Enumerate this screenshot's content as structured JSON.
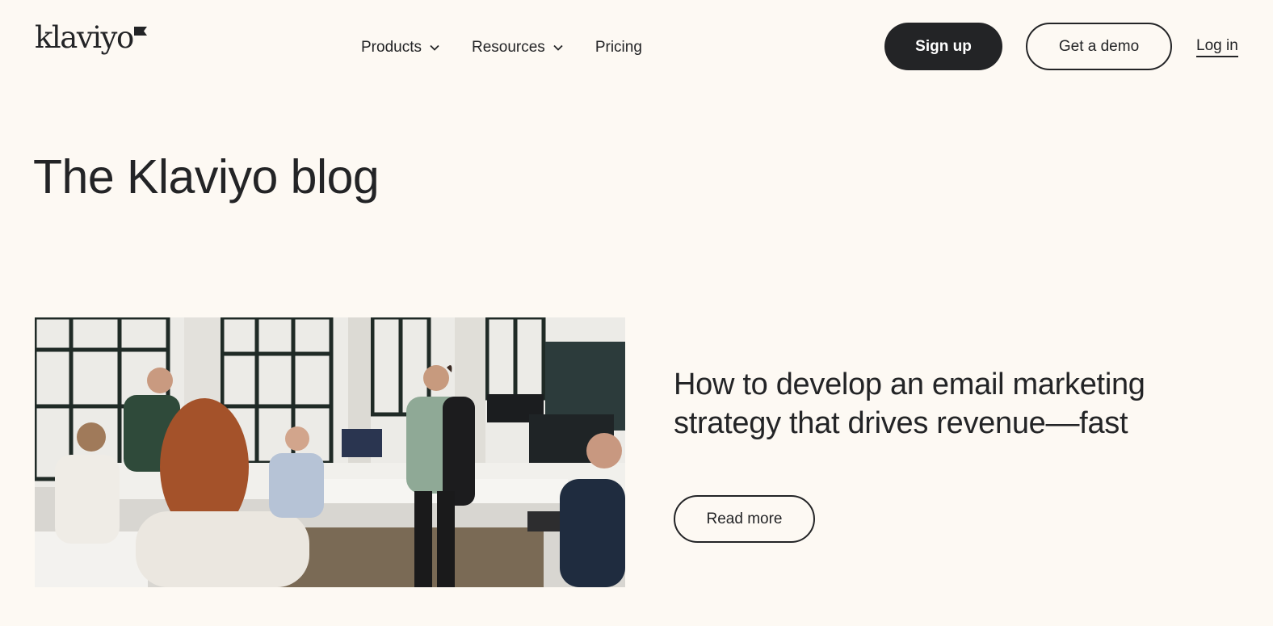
{
  "header": {
    "logo_text": "klaviyo",
    "nav": {
      "products": "Products",
      "resources": "Resources",
      "pricing": "Pricing"
    },
    "signup_label": "Sign up",
    "demo_label": "Get a demo",
    "login_label": "Log in"
  },
  "page": {
    "title": "The Klaviyo blog"
  },
  "featured": {
    "title": "How to develop an email marketing strategy that drives revenue––fast",
    "read_more_label": "Read more"
  }
}
